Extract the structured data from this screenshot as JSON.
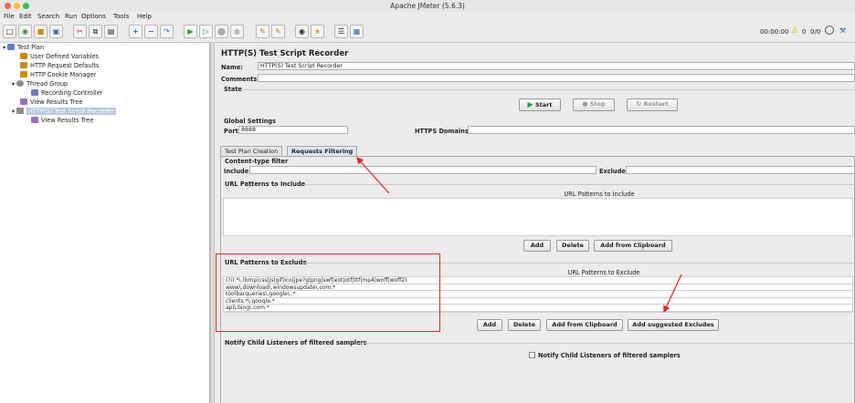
{
  "window": {
    "title": "Apache JMeter (5.6.3)"
  },
  "menu": [
    "File",
    "Edit",
    "Search",
    "Run",
    "Options",
    "Tools",
    "Help"
  ],
  "toolbar": {
    "timer": "00:00:00",
    "warnings": "0",
    "threads": "0/0"
  },
  "tree": [
    {
      "label": "Test Plan",
      "icon": "test-plan-icon"
    },
    {
      "label": "User Defined Variables",
      "icon": "wrench-icon"
    },
    {
      "label": "HTTP Request Defaults",
      "icon": "wrench-icon"
    },
    {
      "label": "HTTP Cookie Manager",
      "icon": "wrench-icon"
    },
    {
      "label": "Thread Group",
      "icon": "gear-icon"
    },
    {
      "label": "Recording Controller",
      "icon": "controller-icon"
    },
    {
      "label": "View Results Tree",
      "icon": "listener-icon"
    },
    {
      "label": "HTTP(S) Test Script Recorder",
      "icon": "recorder-icon",
      "selected": true
    },
    {
      "label": "View Results Tree",
      "icon": "listener-icon"
    }
  ],
  "panel": {
    "heading": "HTTP(S) Test Script Recorder",
    "name_label": "Name:",
    "name_value": "HTTP(S) Test Script Recorder",
    "comments_label": "Comments:",
    "comments_value": "",
    "state_label": "State",
    "start": "Start",
    "stop": "Stop",
    "restart": "Restart",
    "global_settings": "Global Settings",
    "port_label": "Port:",
    "port_value": "8888",
    "https_label": "HTTPS Domains:",
    "https_value": "",
    "tabs": [
      "Test Plan Creation",
      "Requests Filtering"
    ],
    "content_type_filter": "Content-type filter",
    "include_label": "Include:",
    "include_value": "",
    "exclude_label": "Exclude:",
    "exclude_value": "",
    "include_section": "URL Patterns to Include",
    "include_table_header": "URL Patterns to Include",
    "include_buttons": {
      "add": "Add",
      "delete": "Delete",
      "clipboard": "Add from Clipboard"
    },
    "exclude_section": "URL Patterns to Exclude",
    "exclude_table_header": "URL Patterns to Exclude",
    "exclude_rows": [
      "(?i).*\\.(bmp|css|js|gif|ico|jpe?g|png|swf|eot|otf|ttf|mp4|woff|woff2)",
      "www\\.download\\.windowsupdate\\.com.*",
      "toolbarqueries\\.google\\..*",
      "clients.*\\.google.*",
      "api\\.bing\\.com.*"
    ],
    "exclude_buttons": {
      "add": "Add",
      "delete": "Delete",
      "clipboard": "Add from Clipboard",
      "suggested": "Add suggested Excludes"
    },
    "notify_section": "Notify Child Listeners of filtered samplers",
    "notify_checkbox": "Notify Child Listeners of filtered samplers"
  },
  "colors": {
    "annotation_red": "#e0282a",
    "selected_tree": "#b7c7dd",
    "start_green": "#22a33a"
  }
}
